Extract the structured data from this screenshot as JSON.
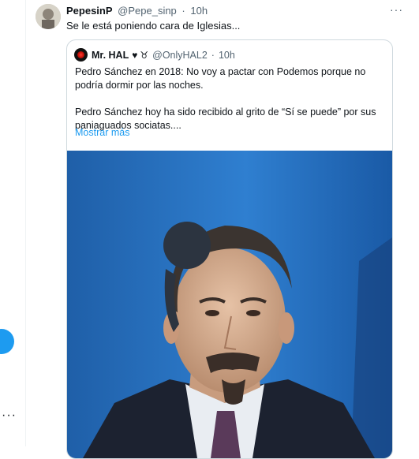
{
  "tweet": {
    "author_name": "PepesinP",
    "author_handle": "@Pepe_sinp",
    "time": "10h",
    "text": "Se le está poniendo cara de Iglesias..."
  },
  "quoted_tweet": {
    "author_name": "Mr. HAL",
    "author_handle": "@OnlyHAL2",
    "time": "10h",
    "name_heart": "♥",
    "name_symbol": "♉",
    "paragraph1": "Pedro Sánchez en 2018: No voy a pactar con Podemos porque no podría dormir por las noches.",
    "paragraph2": "Pedro Sánchez hoy ha sido recibido al grito de “Sí se puede” por sus paniaguados sociatas....",
    "show_more": "Mostrar más"
  },
  "more_options": "···",
  "left_rail": {
    "dots": "···"
  },
  "colors": {
    "accent": "#1d9bf0",
    "text": "#0f1419",
    "muted": "#536471",
    "border": "#cfd9de"
  },
  "icons": [
    "avatar",
    "more-options-icon",
    "heart-icon",
    "taurus-icon",
    "photo"
  ]
}
